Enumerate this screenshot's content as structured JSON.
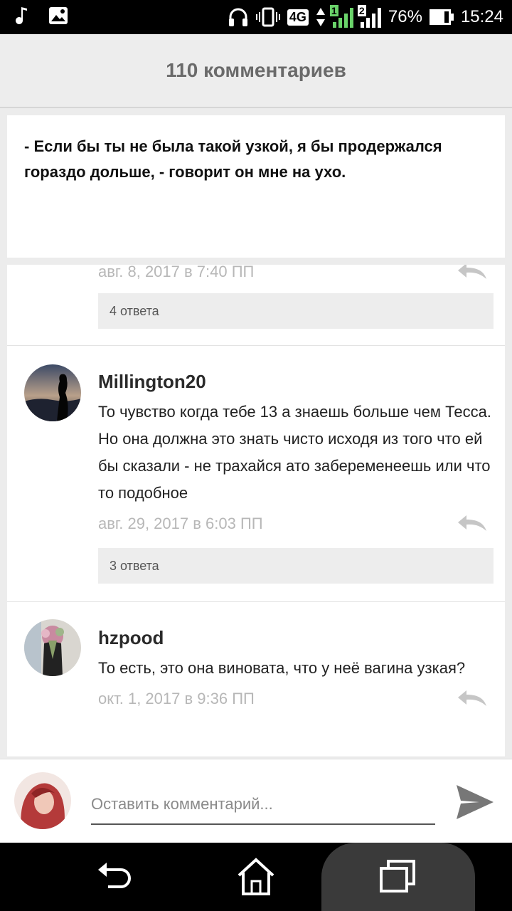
{
  "status_bar": {
    "network": "4G",
    "sim1": "1",
    "sim2": "2",
    "battery": "76%",
    "battery_level": 0.76,
    "time": "15:24",
    "icons": [
      "music-note-icon",
      "image-icon",
      "headphones-icon",
      "vibrate-icon",
      "data-arrows-icon",
      "signal-icon",
      "battery-icon"
    ]
  },
  "header": {
    "title": "110 комментариев"
  },
  "quote": {
    "text": "- Если бы ты не была такой узкой, я бы продержался гораздо дольше, - говорит он мне на ухо."
  },
  "comments": [
    {
      "date": "авг. 8, 2017 в 7:40 ПП",
      "replies": "4 ответа"
    },
    {
      "author": "Millington20",
      "text": "То чувство когда тебе 13 а знаешь больше чем Тесса. Но она должна это знать чисто исходя из того что ей бы сказали - не трахайся ато забеременеешь или что то подобное",
      "date": "авг. 29, 2017 в 6:03 ПП",
      "replies": "3 ответа"
    },
    {
      "author": "hzpood",
      "text": "То есть, это она виновата, что у неё вагина узкая?",
      "date": "окт. 1, 2017 в 9:36 ПП"
    }
  ],
  "composer": {
    "placeholder": "Оставить комментарий..."
  },
  "colors": {
    "accent_gray": "#6a6a6a",
    "meta_gray": "#b7b7b7",
    "reply_box": "#ededed"
  }
}
